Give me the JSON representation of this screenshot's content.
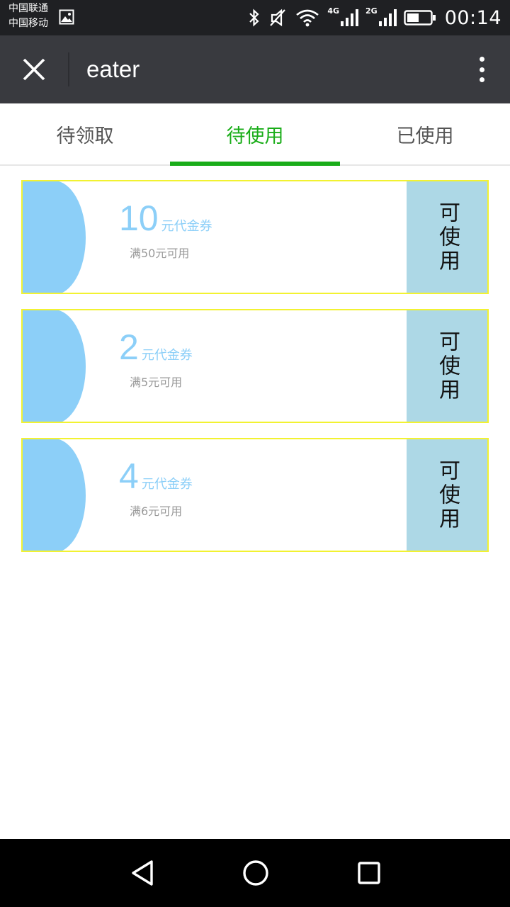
{
  "status_bar": {
    "carrier_1": "中国联通",
    "carrier_2": "中国移动",
    "network_1": "4G",
    "network_2": "2G",
    "time": "00:14",
    "icons": [
      "gallery-icon",
      "bluetooth-icon",
      "mute-icon",
      "wifi-icon",
      "signal-icon",
      "signal-icon",
      "battery-icon"
    ]
  },
  "title_bar": {
    "title": "eater",
    "close_icon": "close-icon",
    "more_icon": "more-vertical-icon"
  },
  "tabs": [
    {
      "label": "待领取",
      "active": false
    },
    {
      "label": "待使用",
      "active": true
    },
    {
      "label": "已使用",
      "active": false
    }
  ],
  "coupons": [
    {
      "amount": "10",
      "unit": "元代金券",
      "condition": "满50元可用",
      "status": "可使用"
    },
    {
      "amount": "2",
      "unit": "元代金券",
      "condition": "满5元可用",
      "status": "可使用"
    },
    {
      "amount": "4",
      "unit": "元代金券",
      "condition": "满6元可用",
      "status": "可使用"
    }
  ],
  "colors": {
    "accent_green": "#1aad19",
    "coupon_blue": "#8ccff8",
    "status_blue": "#add8e6",
    "coupon_border": "#f2f231",
    "title_bar": "#393a3f"
  },
  "nav_bar": {
    "icons": [
      "back-icon",
      "home-icon",
      "recents-icon"
    ]
  }
}
